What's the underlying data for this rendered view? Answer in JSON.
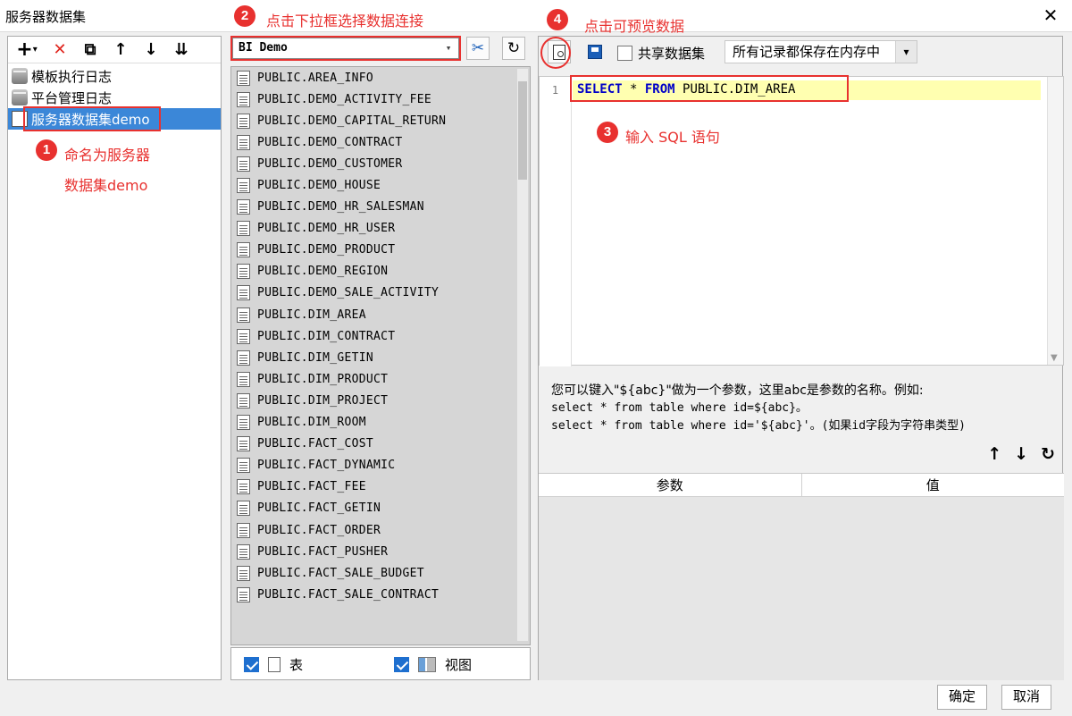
{
  "window": {
    "title": "服务器数据集",
    "close_glyph": "✕"
  },
  "annotations": {
    "step1": {
      "num": "1",
      "line1": "命名为服务器",
      "line2": "数据集demo"
    },
    "step2": {
      "num": "2",
      "text": "点击下拉框选择数据连接"
    },
    "step3": {
      "num": "3",
      "text": "输入 SQL 语句"
    },
    "step4": {
      "num": "4",
      "text": "点击可预览数据"
    }
  },
  "left_toolbar": {
    "add": "+",
    "add_caret": "▾",
    "delete": "✕",
    "copy": "⧉",
    "up": "↑",
    "down": "↓",
    "sort": "⇊"
  },
  "tree": [
    {
      "label": "模板执行日志",
      "icon": "database-icon"
    },
    {
      "label": "平台管理日志",
      "icon": "database-icon"
    },
    {
      "label": "服务器数据集demo",
      "icon": "sql-dataset-icon",
      "selected": true
    }
  ],
  "connection": {
    "selected": "BI Demo",
    "arrow": "▾",
    "settings_glyph": "✂",
    "refresh_glyph": "↻"
  },
  "tables": [
    "PUBLIC.AREA_INFO",
    "PUBLIC.DEMO_ACTIVITY_FEE",
    "PUBLIC.DEMO_CAPITAL_RETURN",
    "PUBLIC.DEMO_CONTRACT",
    "PUBLIC.DEMO_CUSTOMER",
    "PUBLIC.DEMO_HOUSE",
    "PUBLIC.DEMO_HR_SALESMAN",
    "PUBLIC.DEMO_HR_USER",
    "PUBLIC.DEMO_PRODUCT",
    "PUBLIC.DEMO_REGION",
    "PUBLIC.DEMO_SALE_ACTIVITY",
    "PUBLIC.DIM_AREA",
    "PUBLIC.DIM_CONTRACT",
    "PUBLIC.DIM_GETIN",
    "PUBLIC.DIM_PRODUCT",
    "PUBLIC.DIM_PROJECT",
    "PUBLIC.DIM_ROOM",
    "PUBLIC.FACT_COST",
    "PUBLIC.FACT_DYNAMIC",
    "PUBLIC.FACT_FEE",
    "PUBLIC.FACT_GETIN",
    "PUBLIC.FACT_ORDER",
    "PUBLIC.FACT_PUSHER",
    "PUBLIC.FACT_SALE_BUDGET",
    "PUBLIC.FACT_SALE_CONTRACT"
  ],
  "filters": {
    "table_label": "表",
    "view_label": "视图",
    "table_checked": true,
    "view_checked": true
  },
  "right_toolbar": {
    "share_label": "共享数据集",
    "share_checked": false,
    "memory_mode": "所有记录都保存在内存中",
    "memory_arrow": "▾"
  },
  "editor": {
    "line_number": "1",
    "sql_kw1": "SELECT",
    "sql_mid": " * ",
    "sql_kw2": "FROM",
    "sql_rest": " PUBLIC.DIM_AREA"
  },
  "hint": {
    "line1": "您可以键入\"${abc}\"做为一个参数，这里abc是参数的名称。例如:",
    "line2": "select * from table where id=${abc}。",
    "line3": "select * from table where id='${abc}'。(如果id字段为字符串类型)"
  },
  "param_actions": {
    "up": "↑",
    "down": "↓",
    "refresh": "↻"
  },
  "param_table": {
    "col_param": "参数",
    "col_value": "值"
  },
  "footer": {
    "ok": "确定",
    "cancel": "取消"
  },
  "colors": {
    "annotation_red": "#e8312f",
    "selection_blue": "#3b87d8",
    "sql_keyword": "#0000c8",
    "line_highlight": "#ffffb0"
  }
}
